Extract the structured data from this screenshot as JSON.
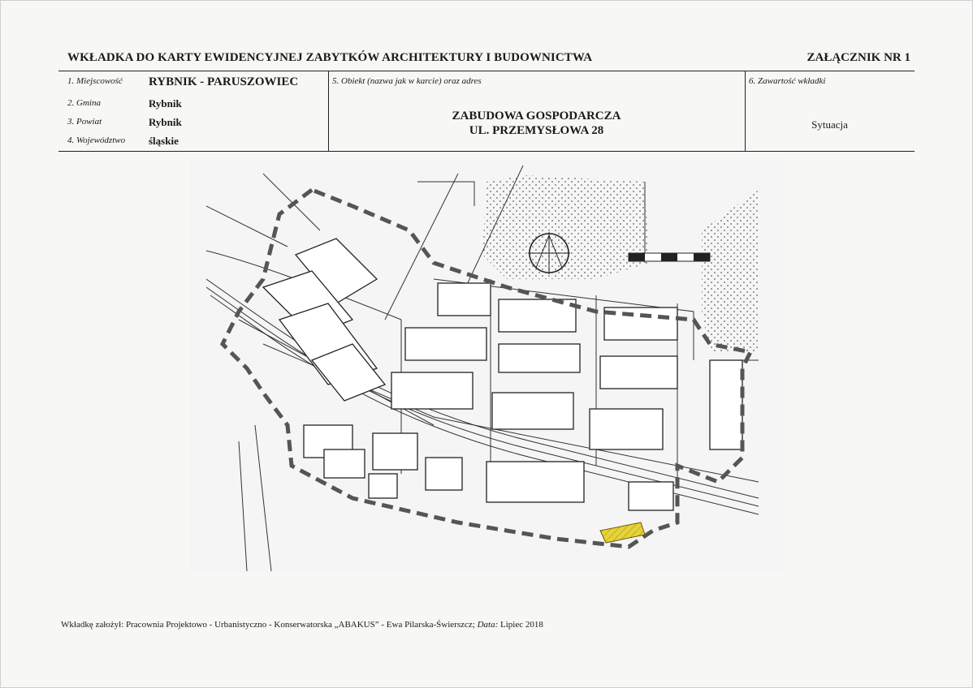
{
  "header": {
    "title": "WKŁADKA DO KARTY EWIDENCYJNEJ ZABYTKÓW ARCHITEKTURY I BUDOWNICTWA",
    "annex": "ZAŁĄCZNIK NR 1"
  },
  "fields": {
    "locality_label": "1. Miejscowość",
    "locality_value": "RYBNIK - PARUSZOWIEC",
    "commune_label": "2. Gmina",
    "commune_value": "Rybnik",
    "district_label": "3. Powiat",
    "district_value": "Rybnik",
    "voivodeship_label": "4. Województwo",
    "voivodeship_value": "śląskie",
    "object_label": "5. Obiekt (nazwa jak w karcie) oraz adres",
    "object_line1": "ZABUDOWA GOSPODARCZA",
    "object_line2": "UL. PRZEMYSŁOWA 28",
    "content_label": "6. Zawartość wkładki",
    "content_value": "Sytuacja"
  },
  "map": {
    "highlight_color": "#e8d23a",
    "boundary_color": "#555555"
  },
  "footer": {
    "prefix": "Wkładkę założył: Pracownia Projektowo - Urbanistyczno - Konserwatorska „ABAKUS” - Ewa Pilarska-Świerszcz;",
    "date_label": "Data:",
    "date_value": "Lipiec 2018"
  }
}
